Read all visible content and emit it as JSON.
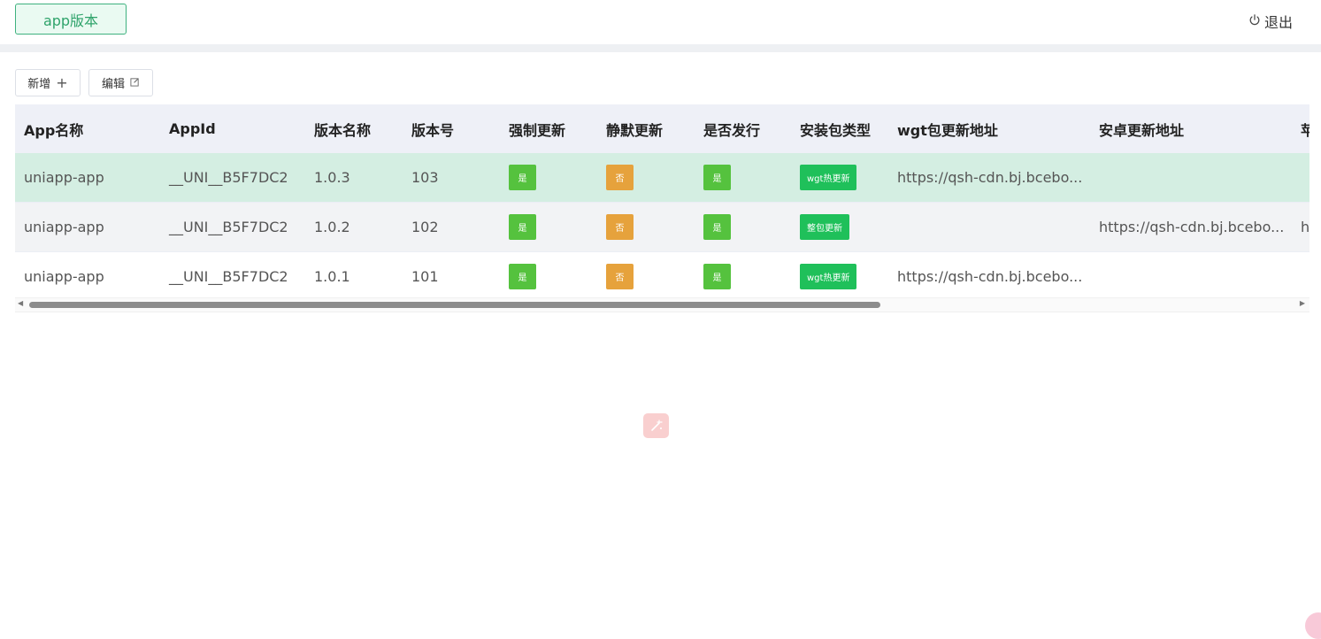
{
  "header": {
    "tab_label": "app版本",
    "logout_label": "退出"
  },
  "toolbar": {
    "add_label": "新增",
    "edit_label": "编辑"
  },
  "table": {
    "columns": [
      "App名称",
      "AppId",
      "版本名称",
      "版本号",
      "强制更新",
      "静默更新",
      "是否发行",
      "安装包类型",
      "wgt包更新地址",
      "安卓更新地址",
      "苹"
    ],
    "rows": [
      {
        "app_name": "uniapp-app",
        "app_id": "__UNI__B5F7DC2",
        "version_name": "1.0.3",
        "version_code": "103",
        "force": "是",
        "silent": "否",
        "published": "是",
        "pkg_type": "wgt热更新",
        "wgt_url": "https://qsh-cdn.bj.bcebo...",
        "android_url": "",
        "ios_url": ""
      },
      {
        "app_name": "uniapp-app",
        "app_id": "__UNI__B5F7DC2",
        "version_name": "1.0.2",
        "version_code": "102",
        "force": "是",
        "silent": "否",
        "published": "是",
        "pkg_type": "整包更新",
        "wgt_url": "",
        "android_url": "https://qsh-cdn.bj.bcebo...",
        "ios_url": "h"
      },
      {
        "app_name": "uniapp-app",
        "app_id": "__UNI__B5F7DC2",
        "version_name": "1.0.1",
        "version_code": "101",
        "force": "是",
        "silent": "否",
        "published": "是",
        "pkg_type": "wgt热更新",
        "wgt_url": "https://qsh-cdn.bj.bcebo...",
        "android_url": "",
        "ios_url": ""
      }
    ]
  },
  "colors": {
    "accent": "#3fb27f",
    "tag_yes": "#55c23e",
    "tag_no": "#e6a23c",
    "tag_pkg": "#1fc05a",
    "row_active": "#d4eee2",
    "header_bg": "#eef0f7"
  },
  "icons": {
    "logout": "power-icon",
    "add": "plus-icon",
    "edit": "edit-icon",
    "floating": "magic-wand-icon"
  }
}
